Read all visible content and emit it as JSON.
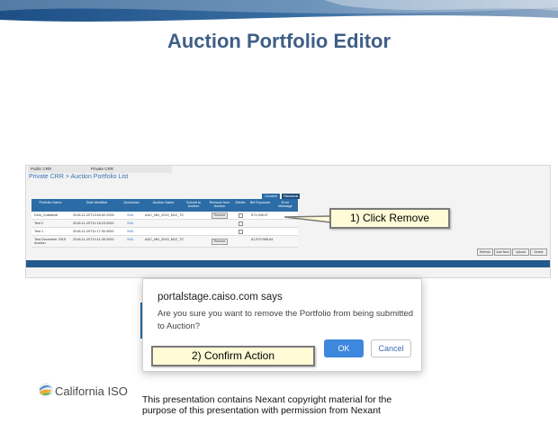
{
  "slide": {
    "title": "Auction Portfolio Editor",
    "callout1": "1) Click Remove",
    "callout2": "2) Confirm Action",
    "logo_text": "California ISO",
    "footer_note": "This presentation contains Nexant copyright material for the purpose of this presentation with permission from Nexant"
  },
  "app": {
    "crr_tabs": [
      "Public CRR",
      "Private CRR"
    ],
    "breadcrumb": "Private CRR > Auction Portfolio List",
    "grid_tabs": [
      "Current",
      "Historical"
    ],
    "columns": [
      "Portfolio Name",
      "Date Modified",
      "Download",
      "Auction Name",
      "Submit to Auction",
      "Remove from Auction",
      "Delete",
      "Bid Exposure",
      "Error Message"
    ],
    "rows": [
      {
        "name": "Dvtn_Collateral",
        "date": "2018-11-20T13:54:42.0000",
        "download": "XML",
        "auction": "AUC_MN_2019_M12_TC",
        "remove": "Remove",
        "exposure": "571,098.07"
      },
      {
        "name": "Test 2",
        "date": "2018-11-20T11:18:23.0000",
        "download": "XML",
        "auction": "",
        "remove": "",
        "exposure": ""
      },
      {
        "name": "Test 1",
        "date": "2018-11-20T11:17:30.0000",
        "download": "XML",
        "auction": "",
        "remove": "",
        "exposure": ""
      },
      {
        "name": "Test December 2019 Auction",
        "date": "2018-11-20T10:11:39.0000",
        "download": "XML",
        "auction": "AUC_MN_2019_M12_TC",
        "remove": "Remove",
        "exposure": "61,979,968.64"
      }
    ],
    "action_buttons": [
      "Refresh",
      "Add New",
      "Upload",
      "Delete"
    ]
  },
  "dialog": {
    "site": "portalstage.caiso.com says",
    "message": "Are you sure you want to remove the Portfolio from being submitted to Auction?",
    "ok_label": "OK",
    "cancel_label": "Cancel"
  },
  "colors": {
    "title": "#3f5f86",
    "app_header": "#2b6ca6",
    "dialog_primary": "#3d87dd",
    "callout_bg": "#fffbd6"
  }
}
